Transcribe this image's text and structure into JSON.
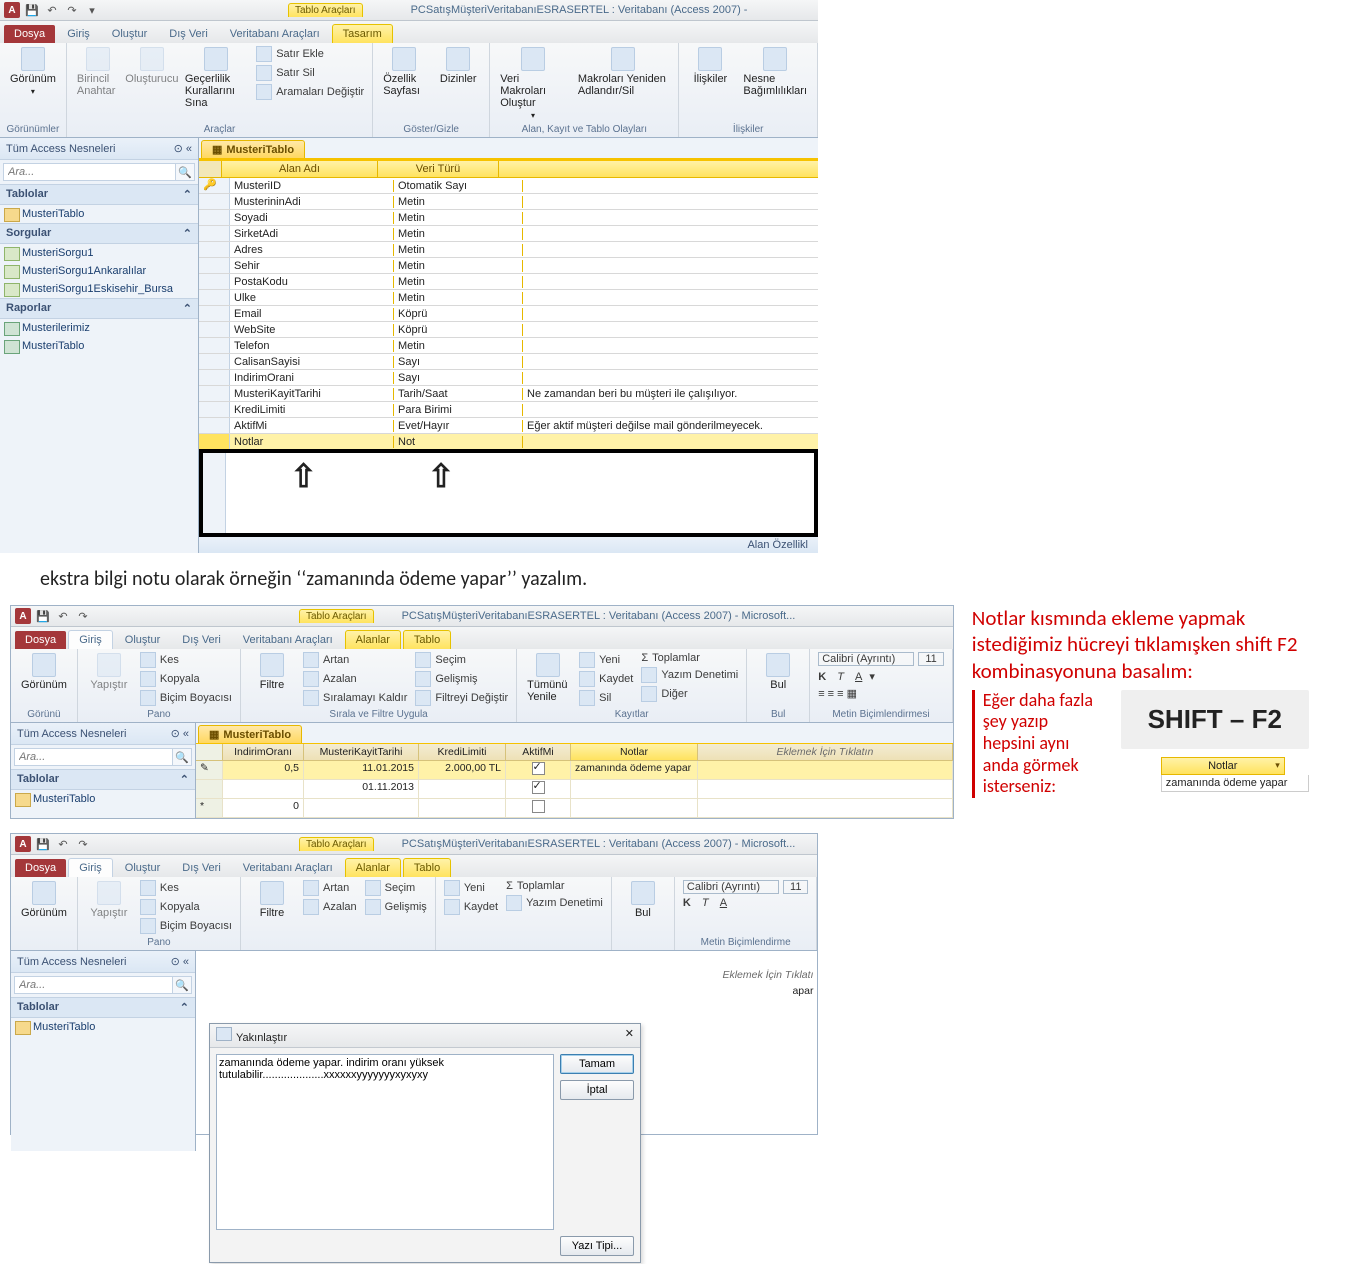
{
  "app_title": "PCSatışMüşteriVeritabanıESRASERTEL : Veritabanı (Access 2007) -",
  "app_title_full": "PCSatışMüşteriVeritabanıESRASERTEL : Veritabanı (Access 2007)  -  Microsoft...",
  "context_tab_group": "Tablo Araçları",
  "tabs": {
    "file": "Dosya",
    "home": "Giriş",
    "create": "Oluştur",
    "ext": "Dış Veri",
    "dbtools": "Veritabanı Araçları",
    "design": "Tasarım",
    "fields": "Alanlar",
    "table": "Tablo"
  },
  "ribbon1": {
    "view": "Görünüm",
    "views_grp": "Görünümler",
    "pk": "Birincil Anahtar",
    "builder": "Oluşturucu",
    "validation": "Geçerlilik Kurallarını Sına",
    "insert_row": "Satır Ekle",
    "delete_row": "Satır Sil",
    "modify_lookups": "Aramaları Değiştir",
    "tools_grp": "Araçlar",
    "propsheet": "Özellik Sayfası",
    "indexes": "Dizinler",
    "showhide_grp": "Göster/Gizle",
    "datamacros": "Veri Makroları Oluştur",
    "rename_macro": "Makroları Yeniden Adlandır/Sil",
    "events_grp": "Alan, Kayıt ve Tablo Olayları",
    "relationships": "İlişkiler",
    "obj_deps": "Nesne Bağımlılıkları",
    "rel_grp": "İlişkiler"
  },
  "nav": {
    "header": "Tüm Access Nesneleri",
    "search_ph": "Ara...",
    "cat_tables": "Tablolar",
    "cat_queries": "Sorgular",
    "cat_reports": "Raporlar",
    "t1": "MusteriTablo",
    "q1": "MusteriSorgu1",
    "q2": "MusteriSorgu1Ankaralılar",
    "q3": "MusteriSorgu1Eskisehir_Bursa",
    "r1": "Musterilerimiz",
    "r2": "MusteriTablo"
  },
  "doc_tab": "MusteriTablo",
  "grid_headers": {
    "field": "Alan Adı",
    "type": "Veri Türü"
  },
  "fields": [
    {
      "name": "MusteriID",
      "type": "Otomatik Sayı",
      "desc": ""
    },
    {
      "name": "MusterininAdi",
      "type": "Metin",
      "desc": ""
    },
    {
      "name": "Soyadi",
      "type": "Metin",
      "desc": ""
    },
    {
      "name": "SirketAdi",
      "type": "Metin",
      "desc": ""
    },
    {
      "name": "Adres",
      "type": "Metin",
      "desc": ""
    },
    {
      "name": "Sehir",
      "type": "Metin",
      "desc": ""
    },
    {
      "name": "PostaKodu",
      "type": "Metin",
      "desc": ""
    },
    {
      "name": "Ulke",
      "type": "Metin",
      "desc": ""
    },
    {
      "name": "Email",
      "type": "Köprü",
      "desc": ""
    },
    {
      "name": "WebSite",
      "type": "Köprü",
      "desc": ""
    },
    {
      "name": "Telefon",
      "type": "Metin",
      "desc": ""
    },
    {
      "name": "CalisanSayisi",
      "type": "Sayı",
      "desc": ""
    },
    {
      "name": "IndirimOrani",
      "type": "Sayı",
      "desc": ""
    },
    {
      "name": "MusteriKayitTarihi",
      "type": "Tarih/Saat",
      "desc": "Ne zamandan beri bu müşteri ile çalışılıyor."
    },
    {
      "name": "KrediLimiti",
      "type": "Para Birimi",
      "desc": ""
    },
    {
      "name": "AktifMi",
      "type": "Evet/Hayır",
      "desc": "Eğer aktif müşteri değilse mail gönderilmeyecek."
    },
    {
      "name": "Notlar",
      "type": "Not",
      "desc": ""
    }
  ],
  "prop_label": "Alan Özellikl",
  "note_main": "ekstra bilgi notu olarak örneğin ‘‘zamanında ödeme yapar’’ yazalım.",
  "note_red_right": "Notlar kısmında ekleme yapmak istediğimiz hücreyi tıklamışken shift F2 kombinasyonuna basalım:",
  "note_red_left": "Eğer  daha fazla şey yazıp hepsini aynı anda görmek isterseniz:",
  "kbd": "SHIFT – F2",
  "mini_notlar": {
    "header": "Notlar",
    "value": "zamanında ödeme yapar"
  },
  "home_ribbon": {
    "view": "Görünüm",
    "paste": "Yapıştır",
    "cut": "Kes",
    "copy": "Kopyala",
    "format_painter": "Biçim Boyacısı",
    "clipboard_grp": "Pano",
    "views_grp": "Görünü",
    "filter": "Filtre",
    "asc": "Artan",
    "desc": "Azalan",
    "remove_sort": "Sıralamayı Kaldır",
    "selection": "Seçim",
    "advanced": "Gelişmiş",
    "toggle_filter": "Filtreyi Değiştir",
    "sort_grp": "Sırala ve Filtre Uygula",
    "refresh": "Tümünü Yenile",
    "new": "Yeni",
    "save": "Kaydet",
    "delete": "Sil",
    "totals": "Toplamlar",
    "spelling": "Yazım Denetimi",
    "more": "Diğer",
    "records_grp": "Kayıtlar",
    "find": "Bul",
    "find_grp": "Bul",
    "font": "Calibri (Ayrıntı)",
    "size": "11",
    "fmt_grp": "Metin Biçimlendirmesi"
  },
  "datasheet": {
    "cols": [
      "IndirimOranı",
      "MusteriKayitTarihi",
      "KrediLimiti",
      "AktifMi",
      "Notlar",
      "Eklemek İçin Tıklatın"
    ],
    "rows": [
      {
        "indirim": "0,5",
        "tarih": "11.01.2015",
        "kredi": "2.000,00 TL",
        "aktif": true,
        "not": "zamanında ödeme yapar"
      },
      {
        "indirim": "",
        "tarih": "01.11.2013",
        "kredi": "",
        "aktif": true,
        "not": ""
      },
      {
        "indirim": "0",
        "tarih": "",
        "kredi": "",
        "aktif": false,
        "not": ""
      }
    ]
  },
  "zoom": {
    "title": "Yakınlaştır",
    "text": "zamanında ödeme yapar. indirim oranı yüksek tutulabilir....................xxxxxxyyyyyyyxyxyxy",
    "ok": "Tamam",
    "cancel": "İptal",
    "font": "Yazı Tipi..."
  },
  "datasheet2_notlar_peek": "apar",
  "datasheet2_click": "Eklemek İçin Tıklatı"
}
